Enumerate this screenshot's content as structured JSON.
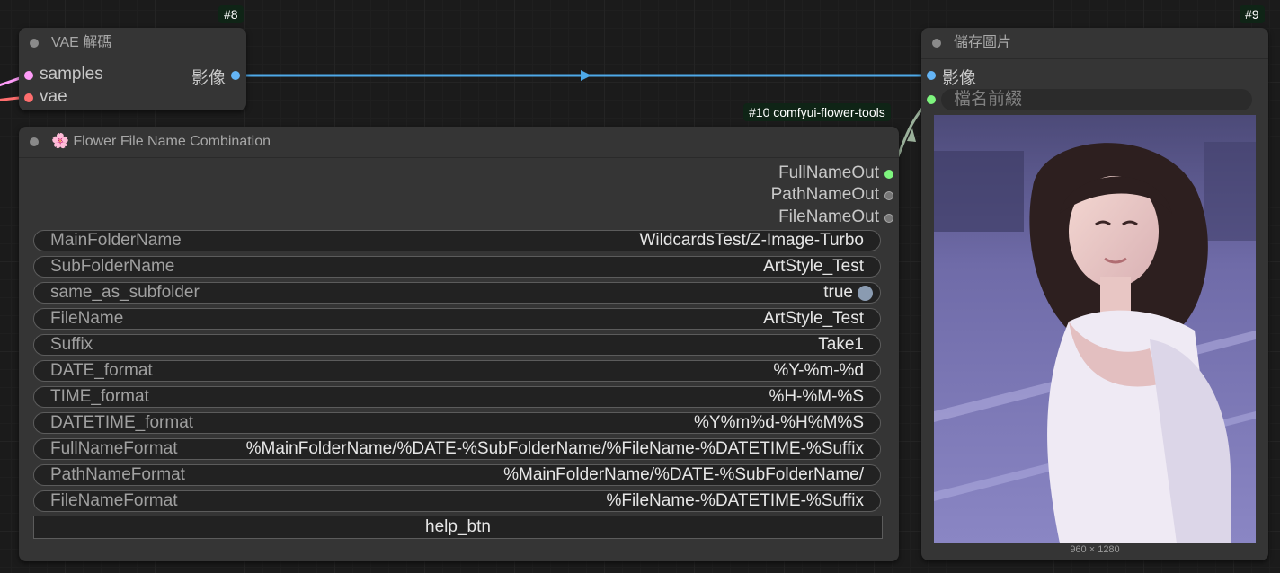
{
  "colors": {
    "link_image": "#4ea9e8",
    "link_filename": "#9ab09a",
    "slot_latent": "#ff9cf9",
    "slot_vae": "#ff6e6e",
    "slot_image": "#64b5f6",
    "slot_string": "#7ef57e",
    "badge_bg": "#0f2416"
  },
  "vae_node": {
    "id_badge": "#8",
    "title": "VAE 解碼",
    "inputs": [
      "samples",
      "vae"
    ],
    "output": "影像"
  },
  "flower_node": {
    "id_badge": "#10 comfyui-flower-tools",
    "title_icon": "cherry-blossom-icon",
    "title": "Flower File Name Combination",
    "outputs": [
      "FullNameOut",
      "PathNameOut",
      "FileNameOut"
    ],
    "widgets": [
      {
        "label": "MainFolderName",
        "value": "WildcardsTest/Z-Image-Turbo"
      },
      {
        "label": "SubFolderName",
        "value": "ArtStyle_Test"
      },
      {
        "label": "same_as_subfolder",
        "value": "true"
      },
      {
        "label": "FileName",
        "value": "ArtStyle_Test"
      },
      {
        "label": "Suffix",
        "value": "Take1"
      },
      {
        "label": "DATE_format",
        "value": "%Y-%m-%d"
      },
      {
        "label": "TIME_format",
        "value": "%H-%M-%S"
      },
      {
        "label": "DATETIME_format",
        "value": "%Y%m%d-%H%M%S"
      },
      {
        "label": "FullNameFormat",
        "value": "%MainFolderName/%DATE-%SubFolderName/%FileName-%DATETIME-%Suffix"
      },
      {
        "label": "PathNameFormat",
        "value": "%MainFolderName/%DATE-%SubFolderName/"
      },
      {
        "label": "FileNameFormat",
        "value": "%FileName-%DATETIME-%Suffix"
      }
    ],
    "button": "help_btn"
  },
  "save_node": {
    "id_badge": "#9",
    "title": "儲存圖片",
    "input_image": "影像",
    "filename_prefix_placeholder": "檔名前綴",
    "image_caption": "960 × 1280"
  }
}
